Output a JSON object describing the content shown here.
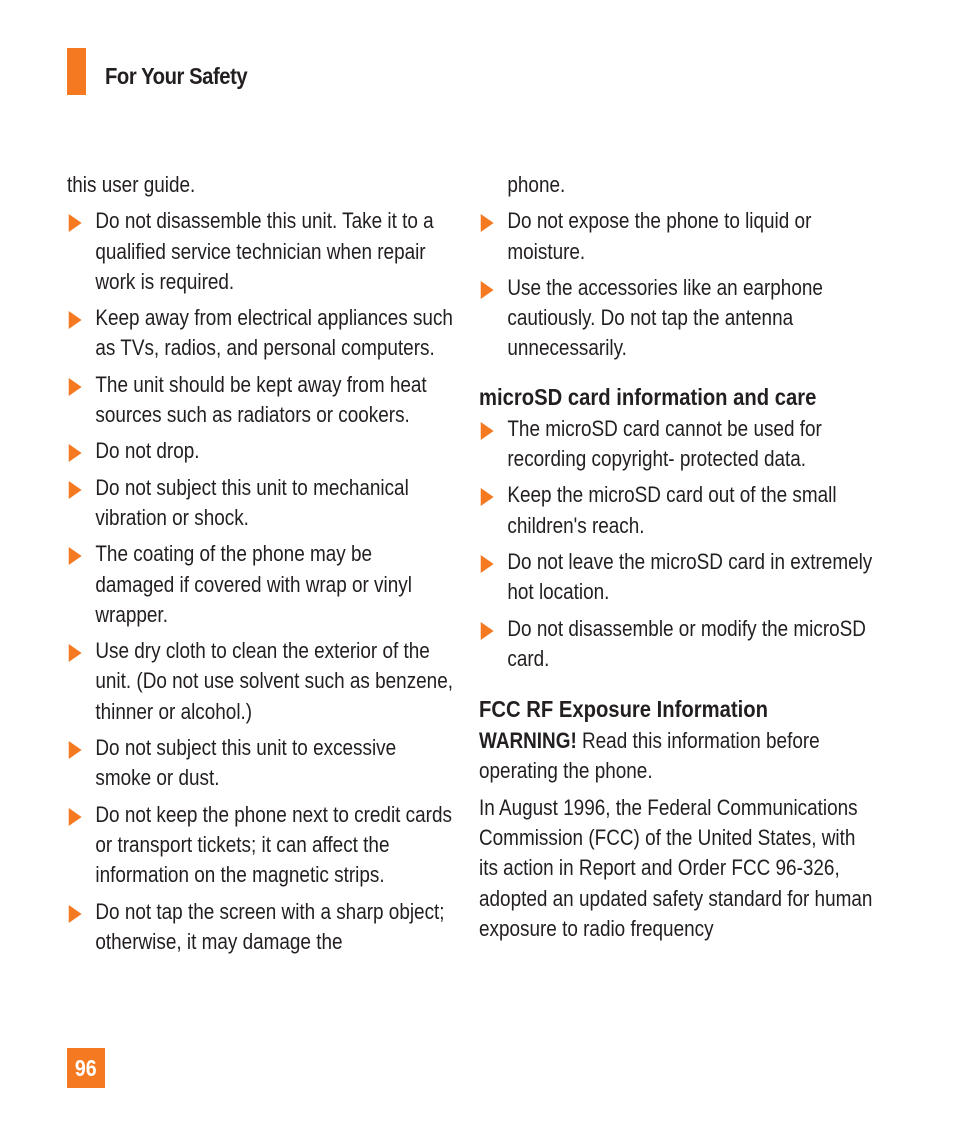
{
  "header": {
    "title": "For Your Safety",
    "accent_color": "#f47920"
  },
  "left_column": {
    "continuation": "this user guide.",
    "bullets": [
      "Do not disassemble this unit. Take it to a qualified service technician when repair work is required.",
      "Keep away from electrical appliances such as TVs, radios, and personal computers.",
      "The unit should be kept away from heat sources such as radiators or cookers.",
      "Do not drop.",
      "Do not subject this unit to mechanical vibration or shock.",
      "The coating of the phone may be damaged if covered with wrap or vinyl wrapper.",
      "Use dry cloth to clean the exterior of the unit. (Do not use solvent such as benzene, thinner or alcohol.)",
      "Do not subject this unit to excessive smoke or dust.",
      "Do not keep the phone next to credit cards or transport tickets; it can affect the information on the magnetic strips.",
      "Do not tap the screen with a sharp object; otherwise, it may damage the"
    ]
  },
  "right_column": {
    "continuation": "phone.",
    "bullets": [
      "Do not expose the phone to liquid or moisture.",
      "Use the accessories like an earphone cautiously. Do not tap the antenna unnecessarily."
    ],
    "microsd": {
      "heading": "microSD card information and care",
      "bullets": [
        "The microSD card cannot be used for recording copyright- protected data.",
        "Keep the microSD card out of the small children's reach.",
        "Do not leave the microSD card in extremely hot location.",
        "Do not disassemble or modify the microSD card."
      ]
    },
    "fcc": {
      "heading": "FCC RF Exposure Information",
      "warning_label": "WARNING!",
      "warning_text": " Read this information before operating the phone.",
      "paragraph": "In August 1996, the Federal Communications Commission (FCC) of the United States, with its action in Report and Order FCC 96-326, adopted an updated safety standard for human exposure to radio frequency"
    }
  },
  "footer": {
    "page_number": "96"
  }
}
